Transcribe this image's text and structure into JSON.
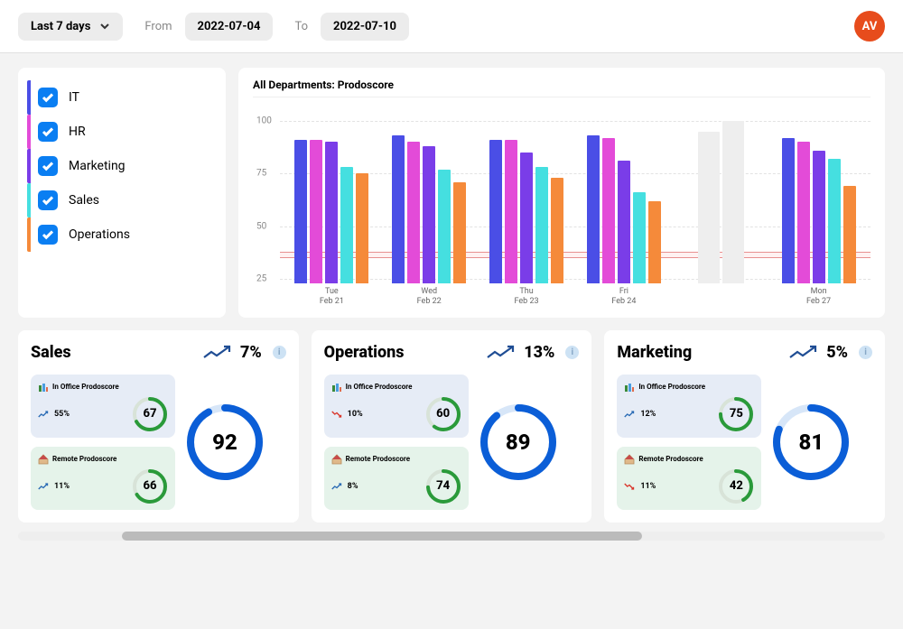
{
  "header": {
    "range_label": "Last 7 days",
    "from_label": "From",
    "to_label": "To",
    "from_date": "2022-07-04",
    "to_date": "2022-07-10",
    "avatar_initials": "AV"
  },
  "legend": {
    "items": [
      {
        "label": "IT",
        "color": "#4a4ee6"
      },
      {
        "label": "HR",
        "color": "#e34bd8"
      },
      {
        "label": "Marketing",
        "color": "#7a3de8"
      },
      {
        "label": "Sales",
        "color": "#45dfe0"
      },
      {
        "label": "Operations",
        "color": "#f58a3a"
      }
    ]
  },
  "chart_data": {
    "type": "bar",
    "title": "All Departments: Prodoscore",
    "ylabel": "",
    "ylim": [
      23,
      100
    ],
    "yticks": [
      25,
      50,
      75,
      100
    ],
    "threshold_band": [
      35,
      38
    ],
    "categories": [
      "Tue\nFeb 21",
      "Wed\nFeb 22",
      "Thu\nFeb 23",
      "Fri\nFeb 24",
      "placeholder",
      "Mon\nFeb 27"
    ],
    "series": [
      {
        "name": "IT",
        "color": "#4a4ee6",
        "values": [
          91,
          93,
          91,
          93,
          null,
          92
        ]
      },
      {
        "name": "HR",
        "color": "#e34bd8",
        "values": [
          91,
          90,
          91,
          92,
          null,
          90
        ]
      },
      {
        "name": "Marketing",
        "color": "#7a3de8",
        "values": [
          90,
          88,
          85,
          81,
          null,
          86
        ]
      },
      {
        "name": "Sales",
        "color": "#45dfe0",
        "values": [
          78,
          77,
          78,
          66,
          null,
          82
        ]
      },
      {
        "name": "Operations",
        "color": "#f58a3a",
        "values": [
          75,
          71,
          73,
          62,
          null,
          69
        ]
      }
    ],
    "placeholder_values": [
      95,
      100
    ]
  },
  "cards": [
    {
      "title": "Sales",
      "trend_dir": "up",
      "trend_pct": "7%",
      "big_score": "92",
      "big_pct": 92,
      "office": {
        "label": "In Office Prodoscore",
        "trend_dir": "up",
        "pct": "55%",
        "score": "67",
        "score_pct": 67
      },
      "remote": {
        "label": "Remote Prodoscore",
        "trend_dir": "up",
        "pct": "11%",
        "score": "66",
        "score_pct": 66
      }
    },
    {
      "title": "Operations",
      "trend_dir": "up",
      "trend_pct": "13%",
      "big_score": "89",
      "big_pct": 89,
      "office": {
        "label": "In Office Prodoscore",
        "trend_dir": "down",
        "pct": "10%",
        "score": "60",
        "score_pct": 60
      },
      "remote": {
        "label": "Remote Prodoscore",
        "trend_dir": "up",
        "pct": "8%",
        "score": "74",
        "score_pct": 74
      }
    },
    {
      "title": "Marketing",
      "trend_dir": "up",
      "trend_pct": "5%",
      "big_score": "81",
      "big_pct": 81,
      "office": {
        "label": "In Office Prodoscore",
        "trend_dir": "up",
        "pct": "12%",
        "score": "75",
        "score_pct": 75
      },
      "remote": {
        "label": "Remote Prodoscore",
        "trend_dir": "down",
        "pct": "11%",
        "score": "42",
        "score_pct": 42
      }
    }
  ],
  "scroll": {
    "thumb_left_pct": 12,
    "thumb_width_pct": 60
  }
}
